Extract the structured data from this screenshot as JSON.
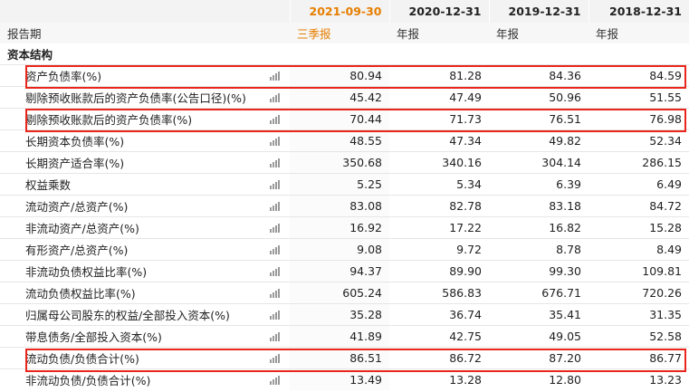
{
  "header": {
    "periods": [
      "2021-09-30",
      "2020-12-31",
      "2019-12-31",
      "2018-12-31"
    ]
  },
  "report_type": {
    "label": "报告期",
    "values": [
      "三季报",
      "年报",
      "年报",
      "年报"
    ]
  },
  "section": {
    "title": "资本结构"
  },
  "icon": "bar-chart-icon",
  "highlight_color": "#e8261b",
  "active_color": "#e67e00",
  "rows": [
    {
      "name": "资产负债率(%)",
      "values": [
        "80.94",
        "81.28",
        "84.36",
        "84.59"
      ]
    },
    {
      "name": "剔除预收账款后的资产负债率(公告口径)(%)",
      "values": [
        "45.42",
        "47.49",
        "50.96",
        "51.55"
      ]
    },
    {
      "name": "剔除预收账款后的资产负债率(%)",
      "values": [
        "70.44",
        "71.73",
        "76.51",
        "76.98"
      ]
    },
    {
      "name": "长期资本负债率(%)",
      "values": [
        "48.55",
        "47.34",
        "49.82",
        "52.34"
      ]
    },
    {
      "name": "长期资产适合率(%)",
      "values": [
        "350.68",
        "340.16",
        "304.14",
        "286.15"
      ]
    },
    {
      "name": "权益乘数",
      "values": [
        "5.25",
        "5.34",
        "6.39",
        "6.49"
      ]
    },
    {
      "name": "流动资产/总资产(%)",
      "values": [
        "83.08",
        "82.78",
        "83.18",
        "84.72"
      ]
    },
    {
      "name": "非流动资产/总资产(%)",
      "values": [
        "16.92",
        "17.22",
        "16.82",
        "15.28"
      ]
    },
    {
      "name": "有形资产/总资产(%)",
      "values": [
        "9.08",
        "9.72",
        "8.78",
        "8.49"
      ]
    },
    {
      "name": "非流动负债权益比率(%)",
      "values": [
        "94.37",
        "89.90",
        "99.30",
        "109.81"
      ]
    },
    {
      "name": "流动负债权益比率(%)",
      "values": [
        "605.24",
        "586.83",
        "676.71",
        "720.26"
      ]
    },
    {
      "name": "归属母公司股东的权益/全部投入资本(%)",
      "values": [
        "35.28",
        "36.74",
        "35.41",
        "31.35"
      ]
    },
    {
      "name": "带息债务/全部投入资本(%)",
      "values": [
        "41.89",
        "42.75",
        "49.05",
        "52.58"
      ]
    },
    {
      "name": "流动负债/负债合计(%)",
      "values": [
        "86.51",
        "86.72",
        "87.20",
        "86.77"
      ]
    },
    {
      "name": "非流动负债/负债合计(%)",
      "values": [
        "13.49",
        "13.28",
        "12.80",
        "13.23"
      ]
    }
  ]
}
